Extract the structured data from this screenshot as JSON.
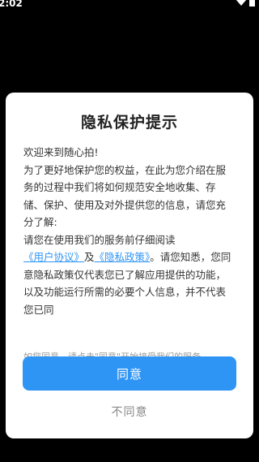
{
  "status_bar": {
    "time": "2:02",
    "icons": [
      "wifi-icon",
      "battery-icon"
    ]
  },
  "dialog": {
    "title": "隐私保护提示",
    "body": {
      "greeting": "欢迎来到随心拍!",
      "paragraph1": "为了更好地保护您的权益，在此为您介绍在服务的过程中我们将如何规范安全地收集、存储、保护、使用及对外提供您的信息，请您充分了解:",
      "paragraph2_prefix": "请您在使用我们的服务前仔细阅读",
      "user_agreement_link": "《用户协议》",
      "and": "及",
      "privacy_policy_link": "《隐私政策》",
      "paragraph2_suffix": "。请您知悉，您同意隐私政策仅代表您已了解应用提供的功能，以及功能运行所需的必要个人信息，并不代表您已同"
    },
    "hint": "如您同意，请点击\"同意\"开始接受我们的服务。",
    "agree_label": "同意",
    "disagree_label": "不同意"
  },
  "colors": {
    "accent": "#2f95f5",
    "background": "#000000",
    "dialog": "#ffffff"
  }
}
